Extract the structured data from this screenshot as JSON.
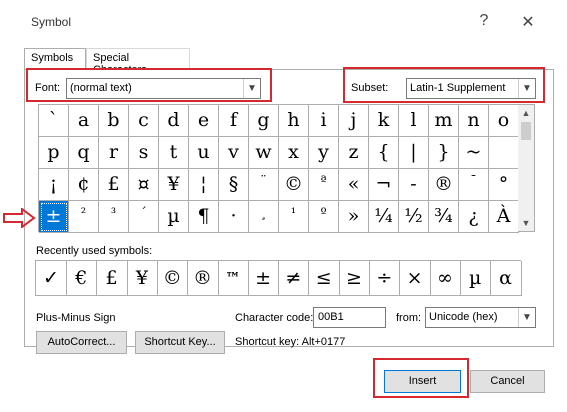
{
  "window": {
    "title": "Symbol",
    "help_glyph": "?",
    "close_glyph": "✕"
  },
  "tabs": [
    {
      "label": "Symbols",
      "active": true
    },
    {
      "label": "Special Characters",
      "active": false
    }
  ],
  "font": {
    "label": "Font:",
    "value": "(normal text)"
  },
  "subset": {
    "label": "Subset:",
    "value": "Latin-1 Supplement"
  },
  "grid": {
    "rows": [
      [
        "`",
        "a",
        "b",
        "c",
        "d",
        "e",
        "f",
        "g",
        "h",
        "i",
        "j",
        "k",
        "l",
        "m",
        "n",
        "o"
      ],
      [
        "p",
        "q",
        "r",
        "s",
        "t",
        "u",
        "v",
        "w",
        "x",
        "y",
        "z",
        "{",
        "|",
        "}",
        "~",
        ""
      ],
      [
        "¡",
        "¢",
        "£",
        "¤",
        "¥",
        "¦",
        "§",
        "¨",
        "©",
        "ª",
        "«",
        "¬",
        "-",
        "®",
        "¯",
        "°"
      ],
      [
        "±",
        "²",
        "³",
        "´",
        "µ",
        "¶",
        "·",
        "¸",
        "¹",
        "º",
        "»",
        "¼",
        "½",
        "¾",
        "¿",
        "À"
      ]
    ],
    "selected_row": 3,
    "selected_col": 0
  },
  "recent": {
    "label": "Recently used symbols:",
    "symbols": [
      "✓",
      "€",
      "£",
      "¥",
      "©",
      "®",
      "™",
      "±",
      "≠",
      "≤",
      "≥",
      "÷",
      "×",
      "∞",
      "µ",
      "α"
    ]
  },
  "char_name": "Plus-Minus Sign",
  "char_code": {
    "label": "Character code:",
    "value": "00B1"
  },
  "from": {
    "label": "from:",
    "value": "Unicode (hex)"
  },
  "buttons": {
    "autocorrect": "AutoCorrect...",
    "shortcut_key": "Shortcut Key...",
    "insert": "Insert",
    "cancel": "Cancel"
  },
  "shortcut_text": "Shortcut key: Alt+0177",
  "colors": {
    "highlight_red": "#d7272f",
    "selection_blue": "#0078d7"
  }
}
